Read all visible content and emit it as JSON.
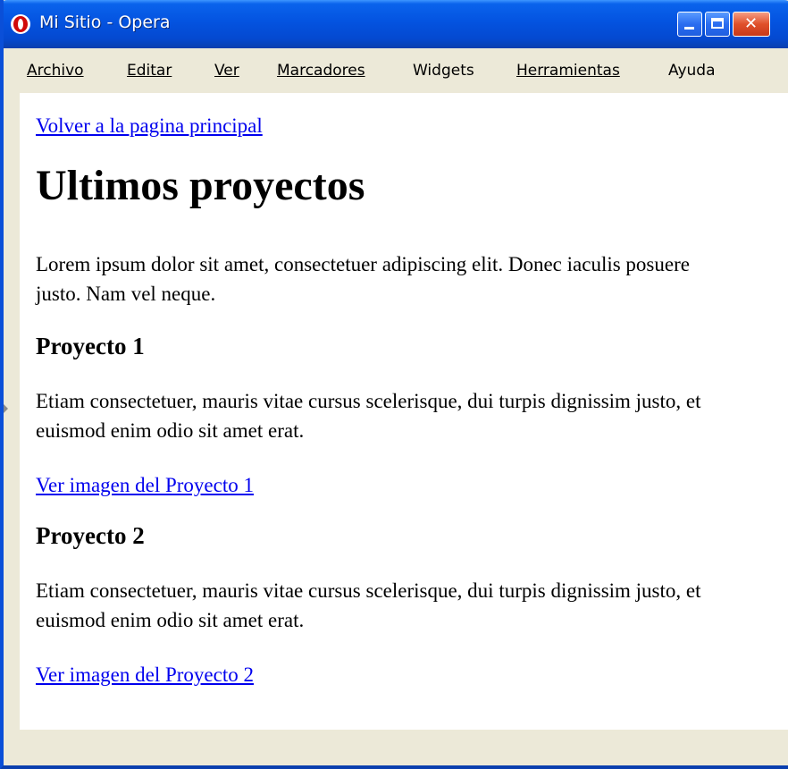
{
  "window": {
    "title": "Mi Sitio - Opera",
    "icon": "opera-icon",
    "controls": {
      "minimize": "minimize-icon",
      "maximize": "maximize-icon",
      "close": "✕"
    }
  },
  "menu": {
    "items": [
      {
        "label": "Archivo"
      },
      {
        "label": "Editar"
      },
      {
        "label": "Ver"
      },
      {
        "label": "Marcadores"
      },
      {
        "label": "Widgets"
      },
      {
        "label": "Herramientas"
      },
      {
        "label": "Ayuda"
      }
    ]
  },
  "page": {
    "back_link": "Volver a la pagina principal",
    "heading": "Ultimos proyectos",
    "intro": "Lorem ipsum dolor sit amet, consectetuer adipiscing elit. Donec iaculis posuere justo. Nam vel neque.",
    "projects": [
      {
        "title": "Proyecto 1",
        "description": "Etiam consectetuer, mauris vitae cursus scelerisque, dui turpis dignissim justo, et euismod enim odio sit amet erat.",
        "link": "Ver imagen del Proyecto 1"
      },
      {
        "title": "Proyecto 2",
        "description": "Etiam consectetuer, mauris vitae cursus scelerisque, dui turpis dignissim justo, et euismod enim odio sit amet erat.",
        "link": "Ver imagen del Proyecto 2"
      }
    ]
  },
  "colors": {
    "titlebar": "#0453e0",
    "chrome": "#ece9d8",
    "link": "#0000ee",
    "close_button": "#e0502a"
  }
}
